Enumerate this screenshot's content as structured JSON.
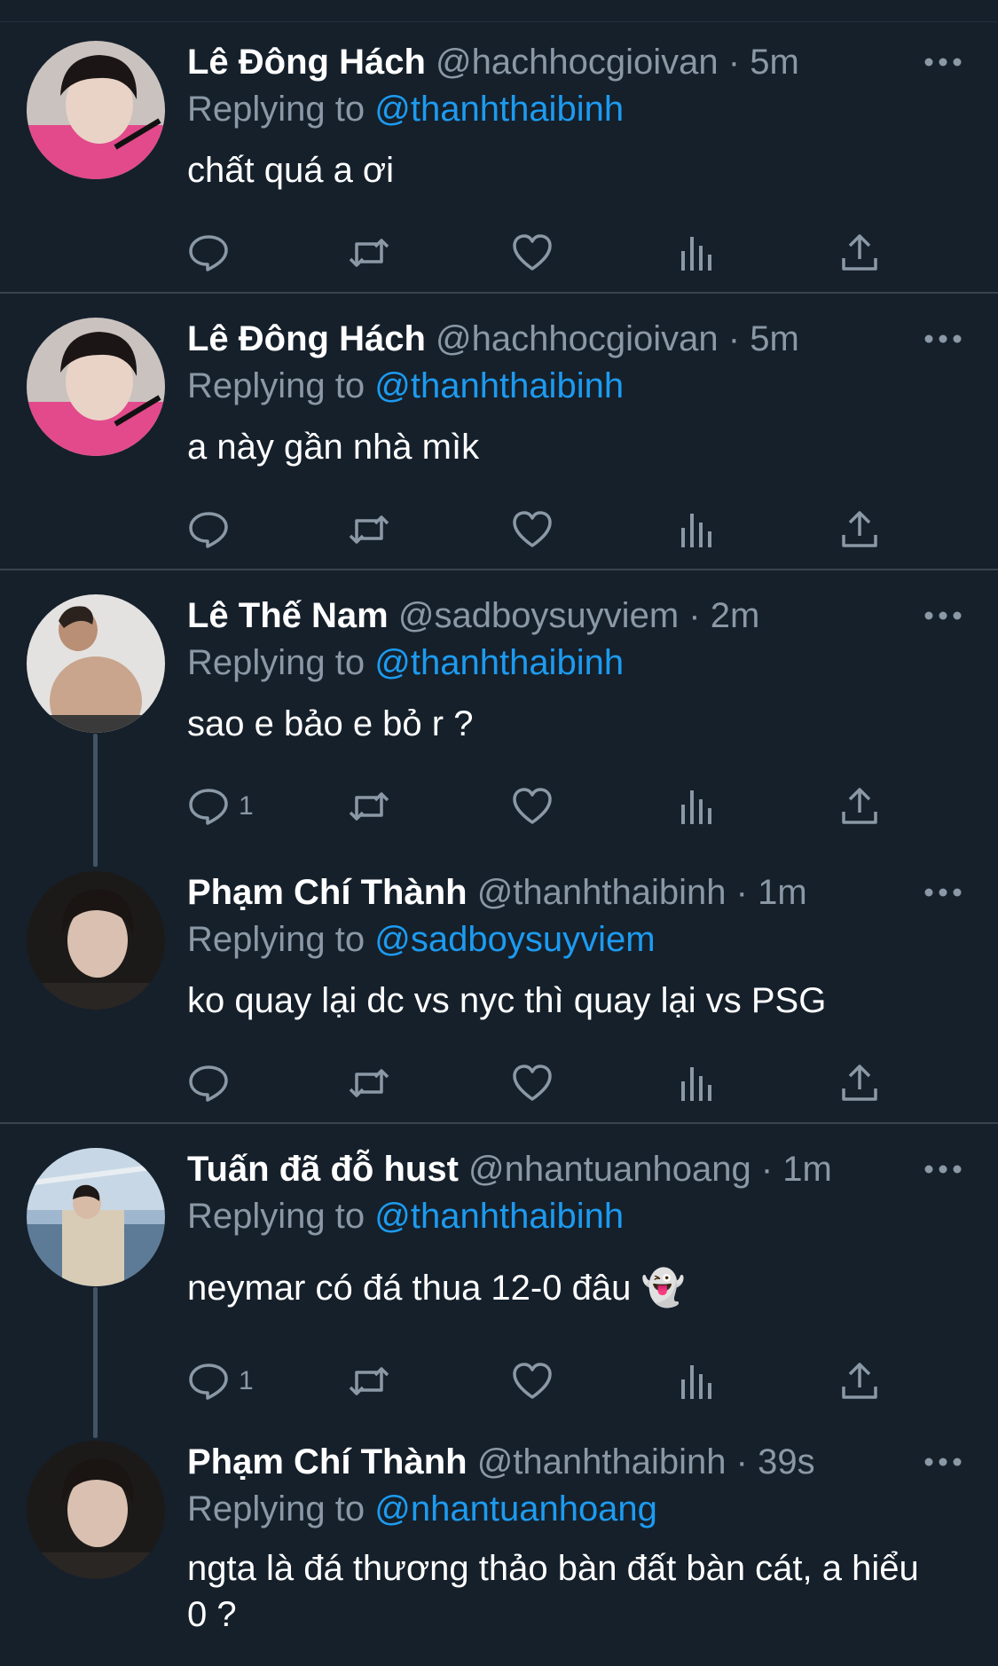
{
  "replying_prefix": "Replying to",
  "tweets": [
    {
      "name": "Lê Đông Hách",
      "handle": "@hachhocgioivan",
      "sep": "·",
      "time": "5m",
      "replying_to": "@thanhthaibinh",
      "text": "chất quá a ơi",
      "reply_count": ""
    },
    {
      "name": "Lê Đông Hách",
      "handle": "@hachhocgioivan",
      "sep": "·",
      "time": "5m",
      "replying_to": "@thanhthaibinh",
      "text": "a này gần nhà mìk",
      "reply_count": ""
    },
    {
      "name": "Lê Thế Nam",
      "handle": "@sadboysuyviem",
      "sep": "·",
      "time": "2m",
      "replying_to": "@thanhthaibinh",
      "text": "sao e bảo e bỏ r ?",
      "reply_count": "1"
    },
    {
      "name": "Phạm Chí Thành",
      "handle": "@thanhthaibinh",
      "sep": "·",
      "time": "1m",
      "replying_to": "@sadboysuyviem",
      "text": "ko quay lại dc vs nyc thì quay lại vs PSG",
      "reply_count": ""
    },
    {
      "name": "Tuấn đã đỗ hust",
      "handle": "@nhantuanhoang",
      "sep": "·",
      "time": "1m",
      "replying_to": "@thanhthaibinh",
      "text": "neymar có đá thua 12-0 đâu 👻",
      "reply_count": "1"
    },
    {
      "name": "Phạm Chí Thành",
      "handle": "@thanhthaibinh",
      "sep": "·",
      "time": "39s",
      "replying_to": "@nhantuanhoang",
      "text": "ngta là đá thương thảo bàn đất bàn cát, a hiểu 0 ?",
      "reply_count": ""
    }
  ],
  "icons": {
    "reply": "reply-icon",
    "retweet": "retweet-icon",
    "like": "heart-icon",
    "views": "views-icon",
    "share": "share-icon",
    "more": "more-icon"
  },
  "colors": {
    "background": "#15202b",
    "text": "#ffffff",
    "secondary": "#8b98a5",
    "link": "#1d9bf0",
    "divider": "#38444d"
  }
}
